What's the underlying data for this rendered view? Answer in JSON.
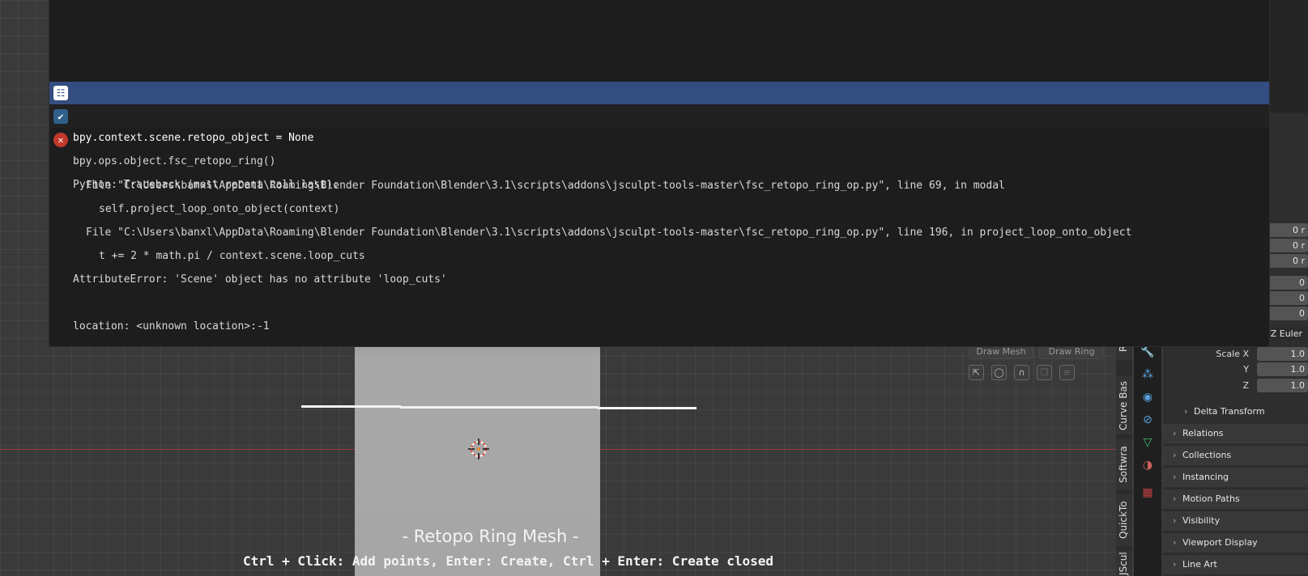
{
  "console": {
    "lines": [
      {
        "text": "bpy.context.scene.retopo_object = None",
        "icon": "property-icon",
        "selected": true
      },
      {
        "text": "bpy.ops.object.fsc_retopo_ring()",
        "icon": "checkmark-icon"
      },
      {
        "text": "Python: Traceback (most recent call last):",
        "icon": "error-icon"
      },
      {
        "text": "File \"C:\\Users\\banxl\\AppData\\Roaming\\Blender Foundation\\Blender\\3.1\\scripts\\addons\\jsculpt-tools-master\\fsc_retopo_ring_op.py\", line 69, in modal"
      },
      {
        "text": "self.project_loop_onto_object(context)"
      },
      {
        "text": "File \"C:\\Users\\banxl\\AppData\\Roaming\\Blender Foundation\\Blender\\3.1\\scripts\\addons\\jsculpt-tools-master\\fsc_retopo_ring_op.py\", line 196, in project_loop_onto_object"
      },
      {
        "text": "t += 2 * math.pi / context.scene.loop_cuts"
      },
      {
        "text": "AttributeError: 'Scene' object has no attribute 'loop_cuts'"
      },
      {
        "text": ""
      },
      {
        "text": "location: <unknown location>:-1"
      }
    ]
  },
  "viewport": {
    "overlay_title": "- Retopo Ring Mesh -",
    "overlay_hint": "Ctrl + Click: Add points, Enter: Create, Ctrl + Enter: Create closed"
  },
  "tool_shelf": {
    "draw_mesh": "Draw Mesh",
    "draw_ring": "Draw Ring"
  },
  "side_tabs": [
    "Rar",
    "Curve Bas",
    "Softwra",
    "QuickTo",
    "JScul"
  ],
  "properties": {
    "location_values": [
      "0 r",
      "0 r",
      "0 r"
    ],
    "rotation_values": [
      "0",
      "0",
      "0"
    ],
    "rotation_mode": "YZ Euler",
    "scale": {
      "x_label": "Scale X",
      "y_label": "Y",
      "z_label": "Z",
      "x": "1.0",
      "y": "1.0",
      "z": "1.0"
    },
    "delta_transform": "Delta Transform",
    "sections": [
      "Relations",
      "Collections",
      "Instancing",
      "Motion Paths",
      "Visibility",
      "Viewport Display",
      "Line Art"
    ]
  },
  "colors": {
    "selection": "#334d80",
    "error": "#c0392b",
    "check": "#2f5f8a",
    "x_axis": "#9b3b3b"
  }
}
